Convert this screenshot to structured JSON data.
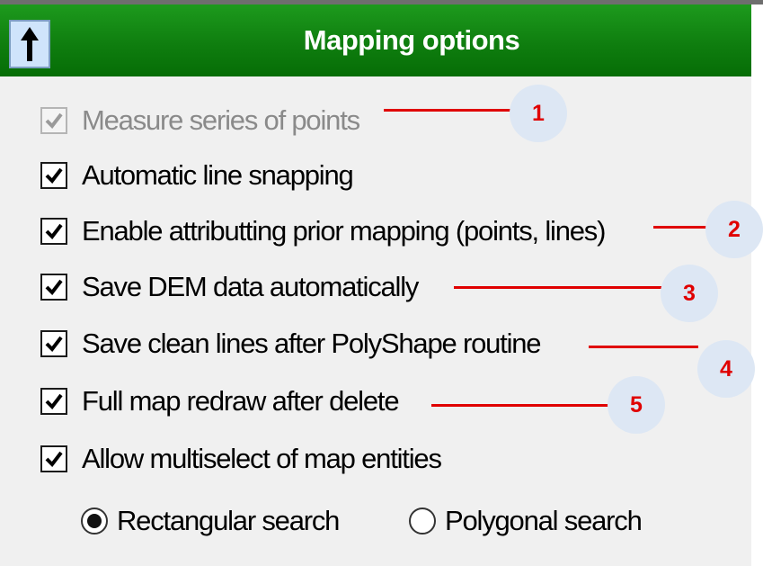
{
  "header": {
    "title": "Mapping options",
    "up_icon": "arrow-up-icon",
    "background_color": "#0f7e0f"
  },
  "options": [
    {
      "label": "Measure series of points",
      "checked": true,
      "enabled": false
    },
    {
      "label": "Automatic line snapping",
      "checked": true,
      "enabled": true
    },
    {
      "label": "Enable attributting prior mapping (points, lines)",
      "checked": true,
      "enabled": true
    },
    {
      "label": "Save DEM data automatically",
      "checked": true,
      "enabled": true
    },
    {
      "label": "Save clean lines after PolyShape routine",
      "checked": true,
      "enabled": true
    },
    {
      "label": "Full map redraw after delete",
      "checked": true,
      "enabled": true
    },
    {
      "label": "Allow multiselect of map entities",
      "checked": true,
      "enabled": true
    }
  ],
  "search_mode": {
    "options": [
      "Rectangular search",
      "Polygonal search"
    ],
    "selected": "Rectangular search"
  },
  "callouts": [
    "1",
    "2",
    "3",
    "4",
    "5"
  ],
  "annotation_color": "#e00000"
}
